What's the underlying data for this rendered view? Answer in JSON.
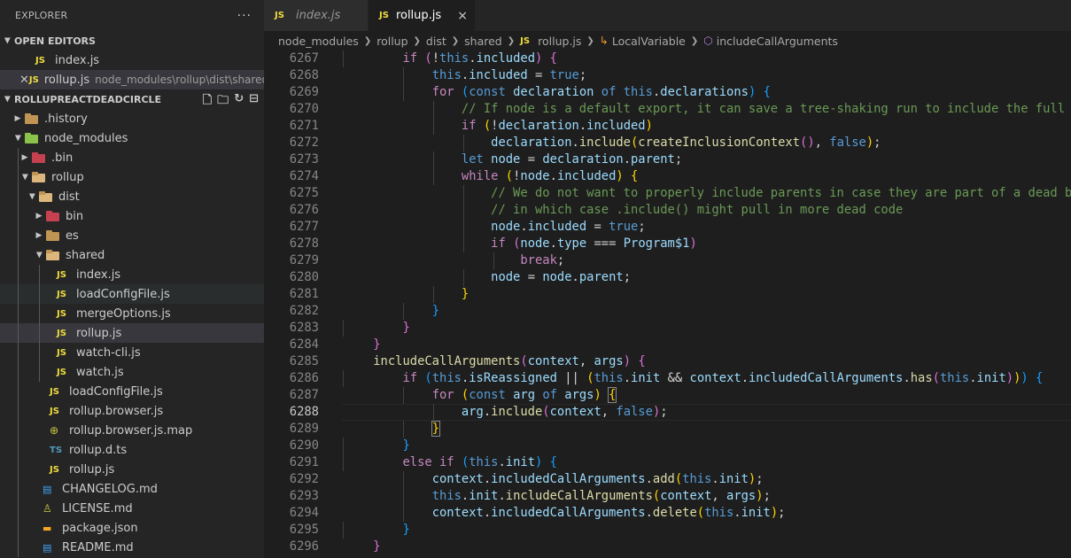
{
  "sidebar": {
    "title": "EXPLORER",
    "more": "···",
    "open_editors_label": "OPEN EDITORS",
    "open_editors": [
      {
        "name": "index.js",
        "path": ""
      },
      {
        "name": "rollup.js",
        "path": "node_modules\\rollup\\dist\\shared"
      }
    ],
    "project_label": "ROLLUPREACTDEADCIRCLE",
    "tree": [
      {
        "name": ".history"
      },
      {
        "name": "node_modules"
      },
      {
        "name": ".bin"
      },
      {
        "name": "rollup"
      },
      {
        "name": "dist"
      },
      {
        "name": "bin"
      },
      {
        "name": "es"
      },
      {
        "name": "shared"
      },
      {
        "name": "index.js"
      },
      {
        "name": "loadConfigFile.js"
      },
      {
        "name": "mergeOptions.js"
      },
      {
        "name": "rollup.js"
      },
      {
        "name": "watch-cli.js"
      },
      {
        "name": "watch.js"
      },
      {
        "name": "loadConfigFile.js"
      },
      {
        "name": "rollup.browser.js"
      },
      {
        "name": "rollup.browser.js.map"
      },
      {
        "name": "rollup.d.ts"
      },
      {
        "name": "rollup.js"
      },
      {
        "name": "CHANGELOG.md"
      },
      {
        "name": "LICENSE.md"
      },
      {
        "name": "package.json"
      },
      {
        "name": "README.md"
      }
    ]
  },
  "tabs": [
    {
      "label": "index.js",
      "icon": "JS"
    },
    {
      "label": "rollup.js",
      "icon": "JS",
      "close": "×"
    }
  ],
  "breadcrumb": {
    "items": [
      "node_modules",
      "rollup",
      "dist",
      "shared",
      "rollup.js",
      "LocalVariable",
      "includeCallArguments"
    ],
    "js_icon": "JS"
  },
  "editor": {
    "line_numbers": [
      "6267",
      "6268",
      "6269",
      "6270",
      "6271",
      "6272",
      "6273",
      "6274",
      "6275",
      "6276",
      "6277",
      "6278",
      "6279",
      "6280",
      "6281",
      "6282",
      "6283",
      "6284",
      "6285",
      "6286",
      "6287",
      "6288",
      "6289",
      "6290",
      "6291",
      "6292",
      "6293",
      "6294",
      "6295",
      "6296"
    ],
    "current_line": "6288"
  },
  "colors": {
    "sidebar_bg": "#252526",
    "editor_bg": "#1e1e1e",
    "keyword": "#c586c0",
    "variable": "#9cdcfe",
    "function": "#dcdcaa",
    "comment": "#6a9955"
  }
}
